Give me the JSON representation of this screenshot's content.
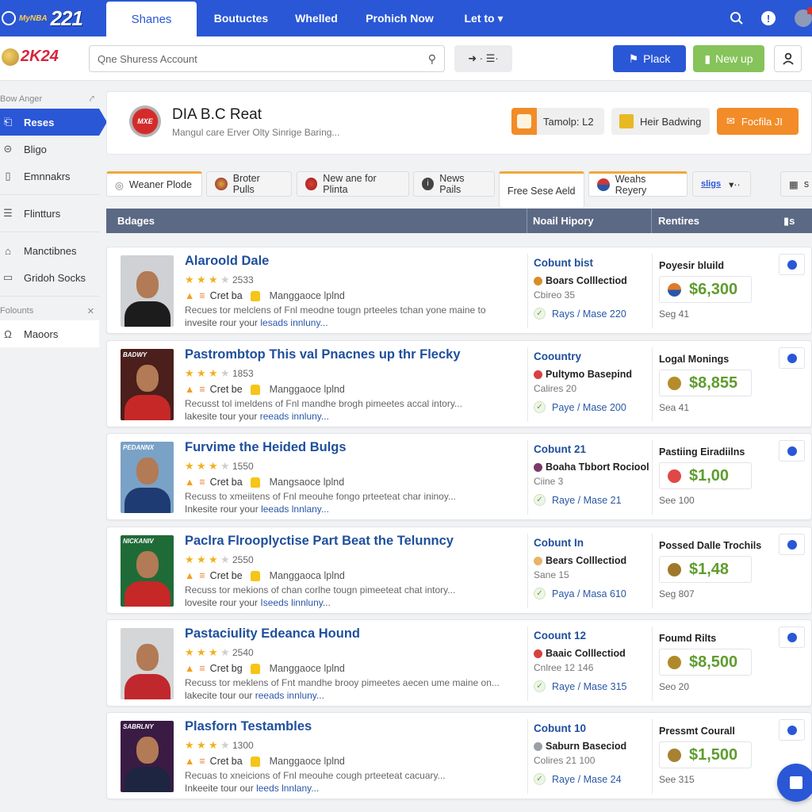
{
  "topnav": {
    "brand": "221",
    "brand_prefix": "MyNBA",
    "tabs": [
      {
        "label": "Shanes",
        "active": true
      },
      {
        "label": "Boutuctes",
        "active": false
      },
      {
        "label": "Whelled",
        "active": false
      },
      {
        "label": "Prohich Now",
        "active": false
      },
      {
        "label": "Let to ▾",
        "active": false
      }
    ],
    "icons": [
      "search-icon",
      "info-icon",
      "user-avatar"
    ]
  },
  "subbar": {
    "logo": "2K24",
    "search": {
      "placeholder": "Qne Shuress Account",
      "value": ""
    },
    "filter_label": "➜ · ☰·",
    "buttons": {
      "place": "Plack",
      "new": "New up"
    }
  },
  "sidebar": {
    "section1_title": "Bow Anger",
    "items1": [
      {
        "label": "Reses",
        "icon": "⎗",
        "active": true
      },
      {
        "label": "Bligo",
        "icon": "⊝"
      },
      {
        "label": "Emnnakrs",
        "icon": "▯"
      }
    ],
    "items2": [
      {
        "label": "Flintturs",
        "icon": "☰"
      }
    ],
    "items3": [
      {
        "label": "Manctibnes",
        "icon": "⌂"
      },
      {
        "label": "Gridoh Socks",
        "icon": "▭"
      }
    ],
    "section2_title": "Folounts",
    "items4": [
      {
        "label": "Maoors",
        "icon": "Ω"
      }
    ]
  },
  "hero": {
    "logo_text": "MXE",
    "title": "DIA B.C Reat",
    "subtitle": "Mangul care Erver Olty Sinrige Baring...",
    "buttons": {
      "tamolp": "Tamolp: L2",
      "heir": "Heir Badwing",
      "focfila": "Focfila JI"
    }
  },
  "filter_tabs": [
    {
      "label": "Weaner Plode",
      "icon": "◎"
    },
    {
      "label": "Broter Pulls"
    },
    {
      "label": "New ane for Plinta"
    },
    {
      "label": "News Pails"
    },
    {
      "label": "Free Sese Aeld"
    },
    {
      "label": "Weahs Reyery"
    },
    {
      "label": "sligs"
    },
    {
      "label": "s"
    }
  ],
  "table_header": {
    "col1": "Bdages",
    "col2": "Noail Hipory",
    "col3": "Rentires",
    "col4": "s"
  },
  "rows": [
    {
      "title": "Alaroold Dale",
      "stars": 3,
      "score": "2533",
      "meta_a": "Cret ba",
      "meta_b": "Manggaoce lplnd",
      "desc": "Recues tor melclens of Fnl meodne tougn prteeles tchan yone maine to",
      "desc2_a": "invesite rour your",
      "desc2_b": "lesads innluny...",
      "thumb_tag": "",
      "c2_title": "Cobunt bist",
      "c2_coll": "Boars Colllectiod",
      "c2_sub": "Cbireo 35",
      "c2_link": "Rays / Mase 220",
      "c3_title": "Poyesir bluild",
      "price": "$6,300",
      "c3_sub": "Seg 41"
    },
    {
      "title": "Pastrombtop This val Pnacnes up thr Flecky",
      "stars": 3,
      "score": "1853",
      "meta_a": "Cret be",
      "meta_b": "Manggaoce lplnd",
      "desc": "Recusst tol imeldens of Fnl mandhe brogh pimeetes accal intory...",
      "desc2_a": "lakesite tour your",
      "desc2_b": "reeads innluny...",
      "thumb_tag": "BADWY",
      "c2_title": "Coountry",
      "c2_coll": "Pultymo Basepind",
      "c2_sub": "Calires 20",
      "c2_link": "Paye / Mase 200",
      "c3_title": "Logal Monings",
      "price": "$8,855",
      "c3_sub": "Sea 41"
    },
    {
      "title": "Furvime the Heided Bulgs",
      "stars": 3,
      "score": "1550",
      "meta_a": "Cret ba",
      "meta_b": "Mangsaoce lplnd",
      "desc": "Recuss to xmeiitens of Fnl meouhe fongo prteeteat char ininoy...",
      "desc2_a": "Inkesite rour your",
      "desc2_b": "leeads lnnlany...",
      "thumb_tag": "PEDANNX",
      "c2_title": "Cobunt 21",
      "c2_coll": "Boaha Tbbort Rociool",
      "c2_sub": "Ciine 3",
      "c2_link": "Raye / Mase 21",
      "c3_title": "Pastiing Eiradiilns",
      "price": "$1,00",
      "c3_sub": "See 100"
    },
    {
      "title": "Paclra Flrooplyctise Part Beat the Telunncy",
      "stars": 3,
      "score": "2550",
      "meta_a": "Cret be",
      "meta_b": "Manggaoca lplnd",
      "desc": "Recuss tor mekions of chan corlhe tougn pimeeteat chat intory...",
      "desc2_a": "lovesite rour your",
      "desc2_b": "Iseeds linnluny...",
      "thumb_tag": "NICKANIV",
      "c2_title": "Cobunt In",
      "c2_coll": "Bears Colllectiod",
      "c2_sub": "Sane 15",
      "c2_link": "Paya / Masa 610",
      "c3_title": "Possed Dalle Trochils",
      "price": "$1,48",
      "c3_sub": "Seg 807"
    },
    {
      "title": "Pastaciulity Edeanca Hound",
      "stars": 3,
      "score": "2540",
      "meta_a": "Cret bg",
      "meta_b": "Manggaoce lplnd",
      "desc": "Recuss tor meklens of Fnt mandhe brooy pimeetes aecen ume maine on...",
      "desc2_a": "lakecite tour our",
      "desc2_b": "reeads innluny...",
      "thumb_tag": "",
      "c2_title": "Coount 12",
      "c2_coll": "Baaic Colllectiod",
      "c2_sub": "Cnlree 12 146",
      "c2_link": "Raye / Mase 315",
      "c3_title": "Foumd Rilts",
      "price": "$8,500",
      "c3_sub": "Seo 20"
    },
    {
      "title": "Plasforn Testambles",
      "stars": 3,
      "score": "1300",
      "meta_a": "Cret ba",
      "meta_b": "Manggaoce lplnd",
      "desc": "Recuas to xneicions of Fnl meouhe cough prteeteat cacuary...",
      "desc2_a": "Inkeeite tour our",
      "desc2_b": "leeds lnnlany...",
      "thumb_tag": "SABRLNY",
      "c2_title": "Cobunt 10",
      "c2_coll": "Saburn Baseciod",
      "c2_sub": "Colires 21 100",
      "c2_link": "Raye / Mase 24",
      "c3_title": "Pressmt Courall",
      "price": "$1,500",
      "c3_sub": "See 315"
    }
  ],
  "colors": {
    "primary": "#2a57d6",
    "success": "#86c35a",
    "accent": "#f28c28",
    "header": "#5b6984",
    "price": "#5f9c2e"
  }
}
